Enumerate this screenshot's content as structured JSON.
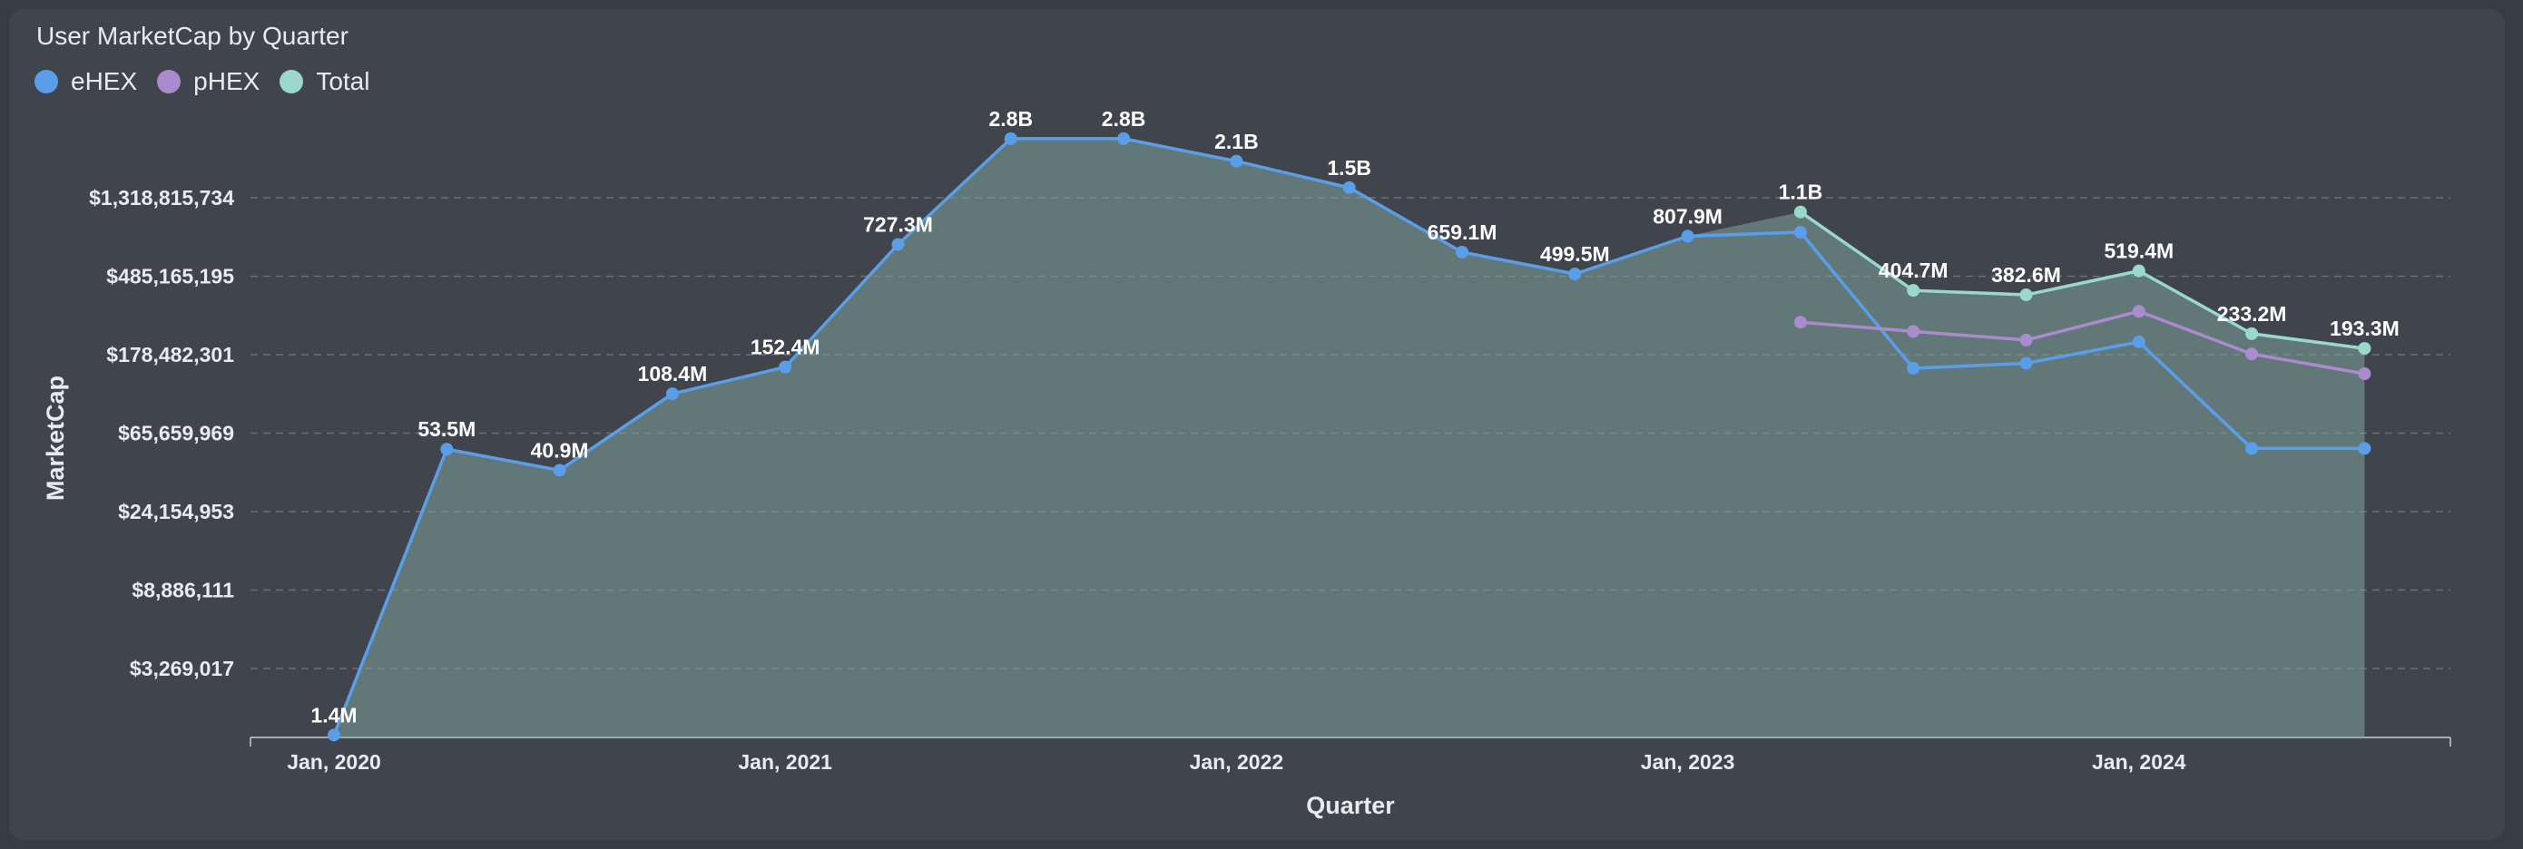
{
  "chart_data": {
    "type": "area",
    "title": "User MarketCap by Quarter",
    "xlabel": "Quarter",
    "ylabel": "MarketCap",
    "y_scale": "log",
    "grid": true,
    "legend_position": "top-left",
    "x_tick_labels": [
      "Jan, 2020",
      "Jan, 2021",
      "Jan, 2022",
      "Jan, 2023",
      "Jan, 2024"
    ],
    "y_tick_labels": [
      "$3,269,017",
      "$8,886,111",
      "$24,154,953",
      "$65,659,969",
      "$178,482,301",
      "$485,165,195",
      "$1,318,815,734"
    ],
    "y_tick_values": [
      3269017,
      8886111,
      24154953,
      65659969,
      178482301,
      485165195,
      1318815734
    ],
    "ylim": [
      1200000,
      4000000000
    ],
    "x": [
      "2020-Q1",
      "2020-Q2",
      "2020-Q3",
      "2020-Q4",
      "2021-Q1",
      "2021-Q2",
      "2021-Q3",
      "2021-Q4",
      "2022-Q1",
      "2022-Q2",
      "2022-Q3",
      "2022-Q4",
      "2023-Q1",
      "2023-Q2",
      "2023-Q3",
      "2023-Q4",
      "2024-Q1",
      "2024-Q2",
      "2024-Q3"
    ],
    "series": [
      {
        "name": "eHEX",
        "color": "#5b9ee8",
        "values": [
          1400000,
          53500000,
          40900000,
          108400000,
          152400000,
          727300000,
          2800000000,
          2800000000,
          2100000000,
          1500000000,
          659100000,
          499500000,
          807900000,
          850000000,
          150000000,
          160000000,
          210000000,
          54000000,
          54000000
        ]
      },
      {
        "name": "pHEX",
        "color": "#a98bce",
        "values": [
          null,
          null,
          null,
          null,
          null,
          null,
          null,
          null,
          null,
          null,
          null,
          null,
          null,
          270000000,
          240000000,
          215000000,
          310000000,
          180000000,
          140000000
        ]
      },
      {
        "name": "Total",
        "color": "#9ad8cc",
        "values": [
          null,
          null,
          null,
          null,
          null,
          null,
          null,
          null,
          null,
          null,
          null,
          null,
          null,
          1100000000,
          404700000,
          382600000,
          519400000,
          233200000,
          193300000
        ]
      }
    ],
    "data_labels": [
      "1.4M",
      "53.5M",
      "40.9M",
      "108.4M",
      "152.4M",
      "727.3M",
      "2.8B",
      "2.8B",
      "2.1B",
      "1.5B",
      "659.1M",
      "499.5M",
      "807.9M",
      "1.1B",
      "404.7M",
      "382.6M",
      "519.4M",
      "233.2M",
      "193.3M"
    ]
  }
}
